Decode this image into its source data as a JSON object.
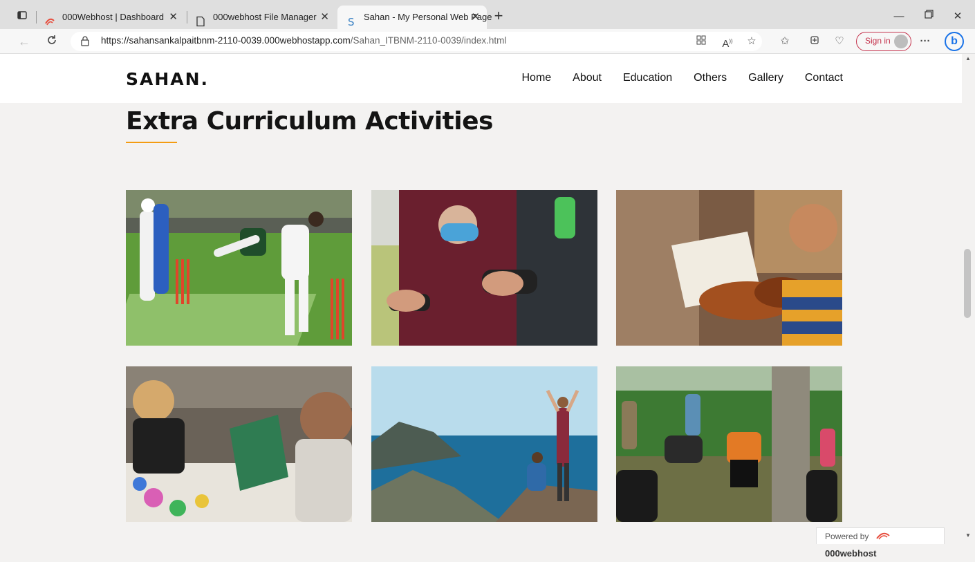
{
  "browser": {
    "tabs": [
      {
        "label": "000Webhost | Dashboard"
      },
      {
        "label": "000webhost File Manager"
      },
      {
        "label": "Sahan - My Personal Web Page"
      }
    ],
    "url_host": "https://sahansankalpaitbnm-2110-0039.000webhostapp.com",
    "url_path": "/Sahan_ITBNM-2110-0039/index.html",
    "signin_label": "Sign in",
    "more_label": "···",
    "bing_label": "b"
  },
  "site": {
    "logo": "SAHAN.",
    "menu": [
      "Home",
      "About",
      "Education",
      "Others",
      "Gallery",
      "Contact"
    ],
    "section_title": "Extra Curriculum Activities",
    "gallery_icons": [
      "cricket-photo-icon",
      "gaming-photo-icon",
      "violin-photo-icon",
      "painting-photo-icon",
      "hiking-photo-icon",
      "gardening-photo-icon"
    ]
  },
  "footer": {
    "powered_prefix": "Powered by",
    "powered_brand": "000webhost"
  },
  "colors": {
    "accent": "#f39c12",
    "page_bg": "#f3f2f1",
    "signin": "#c4314b"
  }
}
